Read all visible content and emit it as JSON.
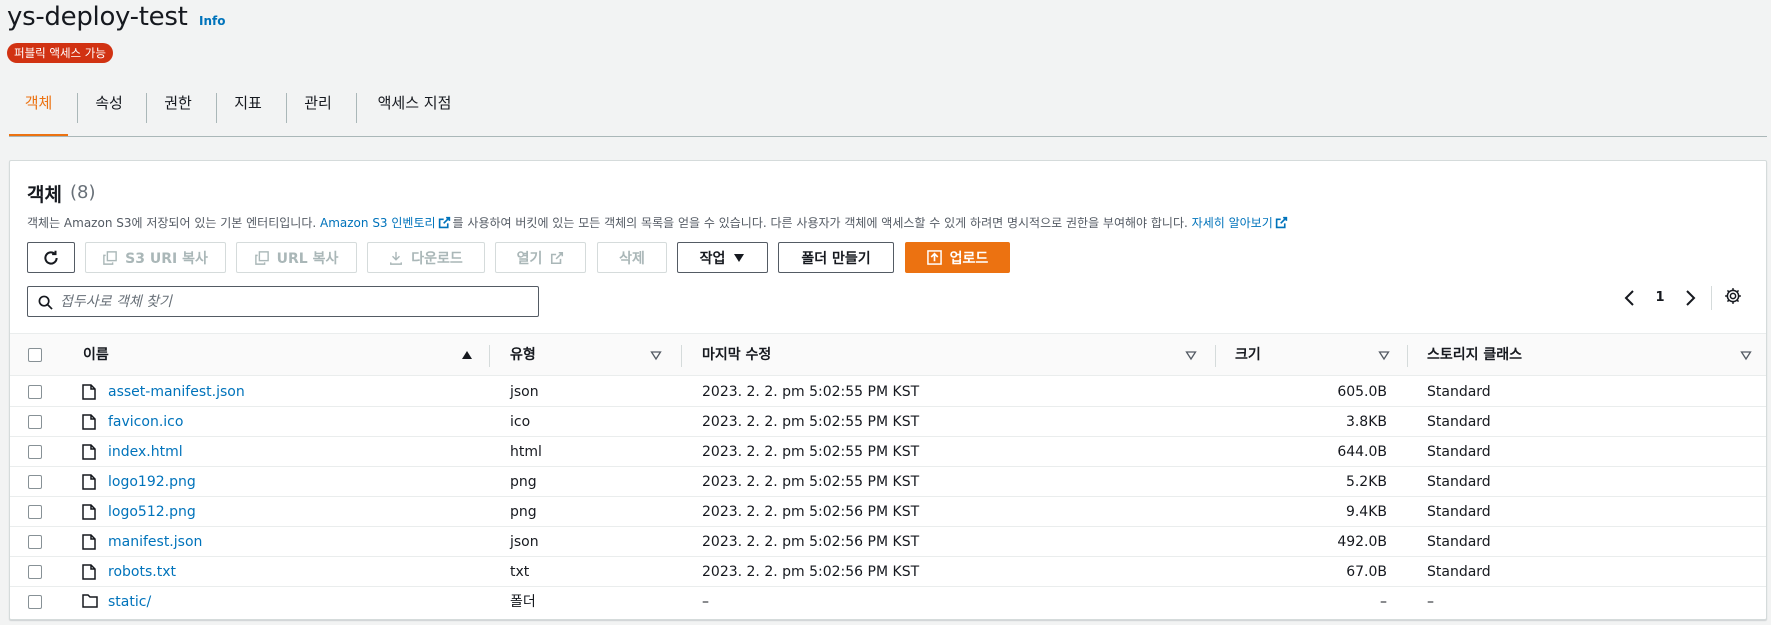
{
  "header": {
    "bucket_name": "ys-deploy-test",
    "info_label": "Info",
    "access_badge": "퍼블릭 액세스 가능"
  },
  "tabs": [
    {
      "label": "객체",
      "active": true
    },
    {
      "label": "속성",
      "active": false
    },
    {
      "label": "권한",
      "active": false
    },
    {
      "label": "지표",
      "active": false
    },
    {
      "label": "관리",
      "active": false
    },
    {
      "label": "액세스 지점",
      "active": false
    }
  ],
  "objects_panel": {
    "title": "객체",
    "count": "(8)",
    "description_part1": "객체는 Amazon S3에 저장되어 있는 기본 엔터티입니다. ",
    "inventory_link": "Amazon S3 인벤토리",
    "description_part2": "를 사용하여 버킷에 있는 모든 객체의 목록을 얻을 수 있습니다. 다른 사용자가 객체에 액세스할 수 있게 하려면 명시적으로 권한을 부여해야 합니다. ",
    "learn_more_link": "자세히 알아보기"
  },
  "toolbar": {
    "refresh_label": "",
    "copy_s3_uri": "S3 URI 복사",
    "copy_url": "URL 복사",
    "download": "다운로드",
    "open": "열기",
    "delete": "삭제",
    "actions": "작업",
    "create_folder": "폴더 만들기",
    "upload": "업로드"
  },
  "search": {
    "placeholder": "접두사로 객체 찾기"
  },
  "pagination": {
    "current_page": "1"
  },
  "table": {
    "columns": [
      "이름",
      "유형",
      "마지막 수정",
      "크기",
      "스토리지 클래스"
    ],
    "rows": [
      {
        "name": "asset-manifest.json",
        "type": "json",
        "modified": "2023. 2. 2. pm 5:02:55 PM KST",
        "size": "605.0B",
        "storage": "Standard",
        "kind": "file"
      },
      {
        "name": "favicon.ico",
        "type": "ico",
        "modified": "2023. 2. 2. pm 5:02:55 PM KST",
        "size": "3.8KB",
        "storage": "Standard",
        "kind": "file"
      },
      {
        "name": "index.html",
        "type": "html",
        "modified": "2023. 2. 2. pm 5:02:55 PM KST",
        "size": "644.0B",
        "storage": "Standard",
        "kind": "file"
      },
      {
        "name": "logo192.png",
        "type": "png",
        "modified": "2023. 2. 2. pm 5:02:55 PM KST",
        "size": "5.2KB",
        "storage": "Standard",
        "kind": "file"
      },
      {
        "name": "logo512.png",
        "type": "png",
        "modified": "2023. 2. 2. pm 5:02:56 PM KST",
        "size": "9.4KB",
        "storage": "Standard",
        "kind": "file"
      },
      {
        "name": "manifest.json",
        "type": "json",
        "modified": "2023. 2. 2. pm 5:02:56 PM KST",
        "size": "492.0B",
        "storage": "Standard",
        "kind": "file"
      },
      {
        "name": "robots.txt",
        "type": "txt",
        "modified": "2023. 2. 2. pm 5:02:56 PM KST",
        "size": "67.0B",
        "storage": "Standard",
        "kind": "file"
      },
      {
        "name": "static/",
        "type": "폴더",
        "modified": "–",
        "size": "–",
        "storage": "–",
        "kind": "folder"
      }
    ]
  },
  "colors": {
    "accent": "#ec7211",
    "link": "#0073bb",
    "badge": "#d13212"
  }
}
